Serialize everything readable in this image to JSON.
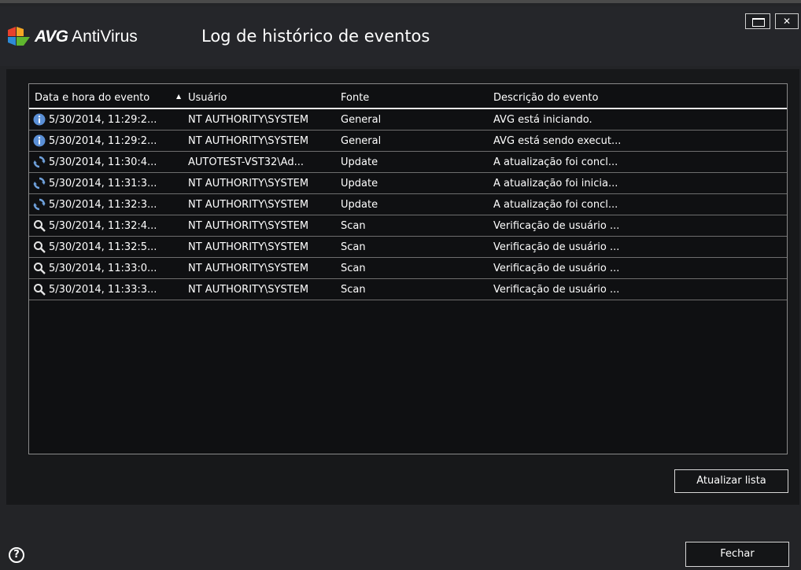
{
  "app": {
    "brand_avg": "AVG",
    "brand_product": "AntiVirus",
    "title": "Log de histórico de eventos",
    "window_controls": {
      "maximize": "maximize-icon",
      "close": "✕"
    }
  },
  "table": {
    "columns": [
      "Data e hora do evento",
      "Usuário",
      "Fonte",
      "Descrição do evento"
    ],
    "sort_column": "Data e hora do evento",
    "sort_direction": "ascending",
    "rows": [
      {
        "icon": "info-icon",
        "date": "5/30/2014, 11:29:2...",
        "user": "NT AUTHORITY\\SYSTEM",
        "source": "General",
        "description": "AVG está iniciando."
      },
      {
        "icon": "info-icon",
        "date": "5/30/2014, 11:29:2...",
        "user": "NT AUTHORITY\\SYSTEM",
        "source": "General",
        "description": "AVG está sendo execut..."
      },
      {
        "icon": "update-icon",
        "date": "5/30/2014, 11:30:4...",
        "user": "AUTOTEST-VST32\\Ad...",
        "source": "Update",
        "description": "A atualização foi concl..."
      },
      {
        "icon": "update-icon",
        "date": "5/30/2014, 11:31:3...",
        "user": "NT AUTHORITY\\SYSTEM",
        "source": "Update",
        "description": "A atualização foi inicia..."
      },
      {
        "icon": "update-icon",
        "date": "5/30/2014, 11:32:3...",
        "user": "NT AUTHORITY\\SYSTEM",
        "source": "Update",
        "description": "A atualização foi concl..."
      },
      {
        "icon": "scan-icon",
        "date": "5/30/2014, 11:32:4...",
        "user": "NT AUTHORITY\\SYSTEM",
        "source": "Scan",
        "description": "Verificação de usuário ..."
      },
      {
        "icon": "scan-icon",
        "date": "5/30/2014, 11:32:5...",
        "user": "NT AUTHORITY\\SYSTEM",
        "source": "Scan",
        "description": "Verificação de usuário ..."
      },
      {
        "icon": "scan-icon",
        "date": "5/30/2014, 11:33:0...",
        "user": "NT AUTHORITY\\SYSTEM",
        "source": "Scan",
        "description": "Verificação de usuário ..."
      },
      {
        "icon": "scan-icon",
        "date": "5/30/2014, 11:33:3...",
        "user": "NT AUTHORITY\\SYSTEM",
        "source": "Scan",
        "description": "Verificação de usuário ..."
      }
    ]
  },
  "buttons": {
    "refresh": "Atualizar lista",
    "close": "Fechar",
    "help": "?"
  },
  "colors": {
    "window_bg": "#232427",
    "list_bg": "#0f1012",
    "info_icon": "#5a8fd6",
    "update_icon": "#6fa1dc",
    "logo_red": "#e8412c",
    "logo_orange": "#f5a623",
    "logo_green": "#5fb62e",
    "logo_blue": "#2e8bd6"
  }
}
